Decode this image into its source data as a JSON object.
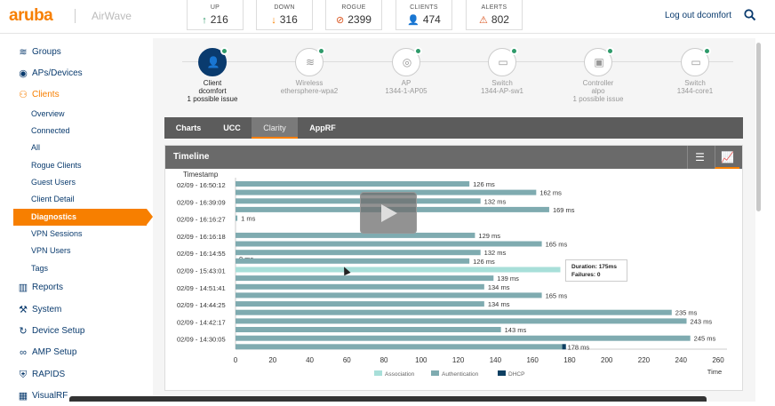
{
  "brand": {
    "logo": "aruba",
    "product": "AirWave"
  },
  "stats": [
    {
      "label": "UP",
      "value": "216",
      "icon": "arrow-up-icon",
      "color": "#2e9a6a"
    },
    {
      "label": "DOWN",
      "value": "316",
      "icon": "arrow-down-icon",
      "color": "#f77f00"
    },
    {
      "label": "ROGUE",
      "value": "2399",
      "icon": "rogue-icon",
      "color": "#d9541e"
    },
    {
      "label": "CLIENTS",
      "value": "474",
      "icon": "clients-icon",
      "color": "#0a3b6e"
    },
    {
      "label": "ALERTS",
      "value": "802",
      "icon": "warning-icon",
      "color": "#d9541e"
    }
  ],
  "header": {
    "logout": "Log out dcomfort"
  },
  "sidebar": {
    "items": [
      {
        "label": "Groups",
        "icon": "wifi-icon"
      },
      {
        "label": "APs/Devices",
        "icon": "ap-icon"
      },
      {
        "label": "Clients",
        "icon": "users-icon"
      },
      {
        "label": "Overview"
      },
      {
        "label": "Connected"
      },
      {
        "label": "All"
      },
      {
        "label": "Rogue Clients"
      },
      {
        "label": "Guest Users"
      },
      {
        "label": "Client Detail"
      },
      {
        "label": "Diagnostics"
      },
      {
        "label": "VPN Sessions"
      },
      {
        "label": "VPN Users"
      },
      {
        "label": "Tags"
      },
      {
        "label": "Reports",
        "icon": "bar-chart-icon"
      },
      {
        "label": "System",
        "icon": "wrench-icon"
      },
      {
        "label": "Device Setup",
        "icon": "refresh-icon"
      },
      {
        "label": "AMP Setup",
        "icon": "link-icon"
      },
      {
        "label": "RAPIDS",
        "icon": "shield-icon"
      },
      {
        "label": "VisualRF",
        "icon": "building-icon"
      }
    ]
  },
  "flow": {
    "nodes": [
      {
        "l1": "Client",
        "l2": "dcomfort",
        "l3": "1 possible issue"
      },
      {
        "l1": "Wireless",
        "l2": "ethersphere-wpa2",
        "l3": ""
      },
      {
        "l1": "AP",
        "l2": "1344-1-AP05",
        "l3": ""
      },
      {
        "l1": "Switch",
        "l2": "1344-AP-sw1",
        "l3": ""
      },
      {
        "l1": "Controller",
        "l2": "alpo",
        "l3": "1 possible issue"
      },
      {
        "l1": "Switch",
        "l2": "1344-core1",
        "l3": ""
      }
    ]
  },
  "tabs": [
    "Charts",
    "UCC",
    "Clarity",
    "AppRF"
  ],
  "panel": {
    "title": "Timeline"
  },
  "tooltip": {
    "duration": "Duration: 175ms",
    "failures": "Failures: 0"
  },
  "chart_data": {
    "type": "bar",
    "orientation": "horizontal",
    "stacked": true,
    "ylabel": "Timestamp",
    "xlabel": "Time",
    "xlim": [
      0,
      260
    ],
    "xticks": [
      0,
      20,
      40,
      60,
      80,
      100,
      120,
      140,
      160,
      180,
      200,
      220,
      240,
      260
    ],
    "timestamps": [
      "02/09 - 16:50:12",
      "02/09 - 16:39:09",
      "02/09 - 16:16:27",
      "02/09 - 16:16:18",
      "02/09 - 16:14:55",
      "02/09 - 15:43:01",
      "02/09 - 14:51:41",
      "02/09 - 14:44:25",
      "02/09 - 14:42:17",
      "02/09 - 14:30:05"
    ],
    "series": [
      {
        "name": "Association",
        "color": "#a8dfd9"
      },
      {
        "name": "Authentication",
        "color": "#7fabb0"
      },
      {
        "name": "DHCP",
        "color": "#0e3f62"
      }
    ],
    "bars": [
      {
        "group": 0,
        "type": "Authentication",
        "value": 126,
        "label": "126 ms"
      },
      {
        "group": 0,
        "type": "Authentication",
        "value": 162,
        "label": "162 ms"
      },
      {
        "group": 1,
        "type": "Authentication",
        "value": 132,
        "label": "132 ms"
      },
      {
        "group": 1,
        "type": "Authentication",
        "value": 169,
        "label": "169 ms"
      },
      {
        "group": 2,
        "type": "Authentication",
        "value": 1,
        "label": "1 ms"
      },
      {
        "group": 3,
        "type": "Authentication",
        "value": 129,
        "label": "129 ms"
      },
      {
        "group": 3,
        "type": "Authentication",
        "value": 165,
        "label": "165 ms"
      },
      {
        "group": 3,
        "type": "Authentication",
        "value": 0,
        "label": "0 ms"
      },
      {
        "group": 4,
        "type": "Authentication",
        "value": 132,
        "label": "132 ms"
      },
      {
        "group": 4,
        "type": "Authentication",
        "value": 126,
        "label": "126 ms"
      },
      {
        "group": 5,
        "type": "Association",
        "value": 175,
        "label": ""
      },
      {
        "group": 5,
        "type": "Authentication",
        "value": 139,
        "label": "139 ms"
      },
      {
        "group": 6,
        "type": "Authentication",
        "value": 134,
        "label": "134 ms"
      },
      {
        "group": 6,
        "type": "Authentication",
        "value": 165,
        "label": "165 ms"
      },
      {
        "group": 7,
        "type": "Authentication",
        "value": 134,
        "label": "134 ms"
      },
      {
        "group": 7,
        "type": "Authentication",
        "value": 235,
        "label": "235 ms"
      },
      {
        "group": 8,
        "type": "Authentication",
        "value": 243,
        "label": "243 ms"
      },
      {
        "group": 8,
        "type": "Authentication",
        "value": 143,
        "label": "143 ms"
      },
      {
        "group": 9,
        "type": "Authentication",
        "value": 245,
        "label": "245 ms"
      },
      {
        "group": 9,
        "type": "Authentication",
        "value": 176,
        "label": "178 ms",
        "dhcp": 2
      }
    ]
  }
}
